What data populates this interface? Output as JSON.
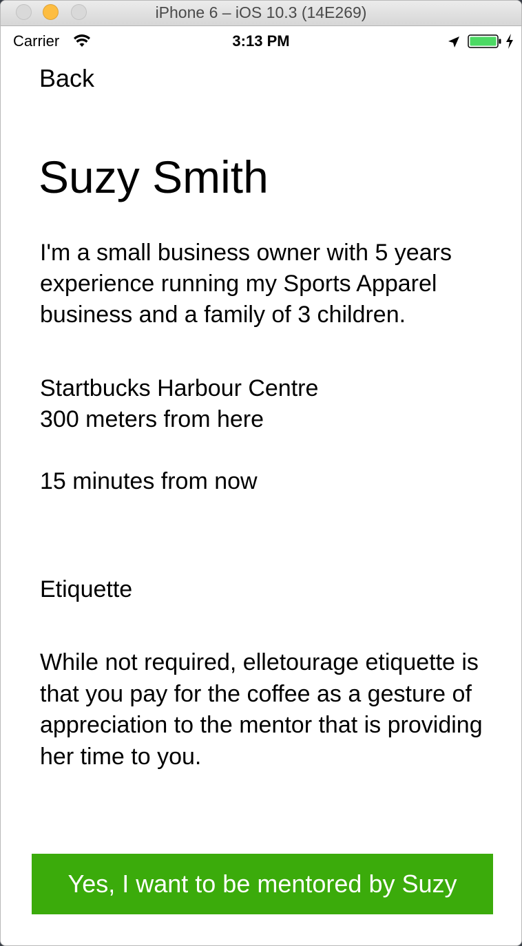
{
  "window": {
    "title": "iPhone 6 – iOS 10.3 (14E269)"
  },
  "status_bar": {
    "carrier": "Carrier",
    "time": "3:13 PM",
    "icons": [
      "wifi-icon",
      "location-arrow-icon",
      "battery-icon",
      "charging-bolt-icon"
    ],
    "battery_color": "#4cd964"
  },
  "nav": {
    "back_label": "Back"
  },
  "mentor": {
    "name": "Suzy Smith",
    "bio": "I'm a small business owner with 5 years experience running my Sports Apparel business and a family of 3 children.",
    "location_name": "Startbucks Harbour Centre",
    "distance": "300 meters from here",
    "time": "15 minutes from now"
  },
  "etiquette": {
    "heading": "Etiquette",
    "text": "While not required, elletourage etiquette is that you pay for the coffee as a gesture of appreciation to the mentor that is providing her time to you."
  },
  "cta": {
    "label": "Yes, I want to be mentored by Suzy",
    "color": "#3bab0b"
  }
}
